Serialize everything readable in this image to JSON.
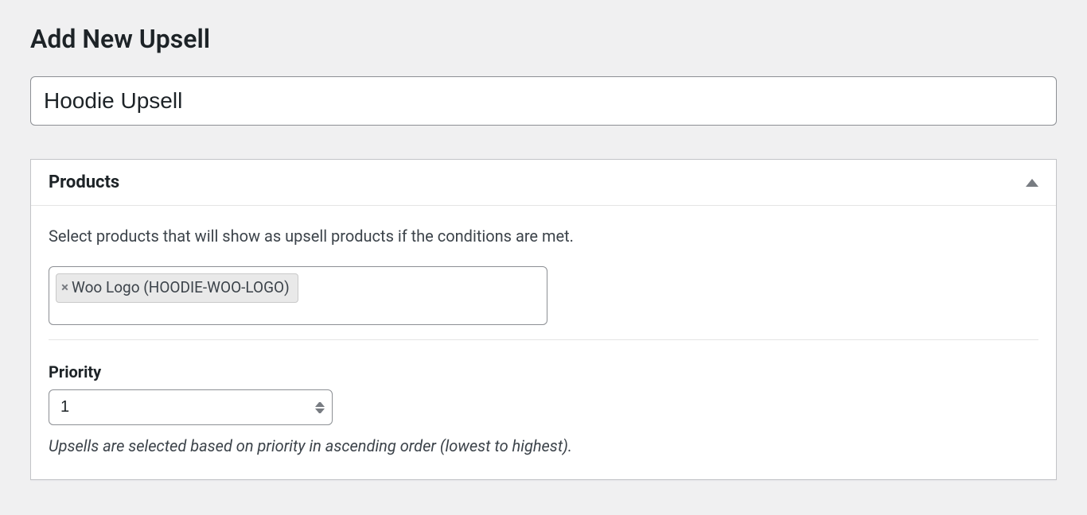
{
  "page": {
    "heading": "Add New Upsell"
  },
  "title_input": {
    "value": "Hoodie Upsell"
  },
  "products_box": {
    "title": "Products",
    "help_text": "Select products that will show as upsell products if the conditions are met.",
    "selected": [
      {
        "label": "Woo Logo (HOODIE-WOO-LOGO)"
      }
    ],
    "priority": {
      "label": "Priority",
      "value": "1",
      "hint": "Upsells are selected based on priority in ascending order (lowest to highest)."
    }
  }
}
